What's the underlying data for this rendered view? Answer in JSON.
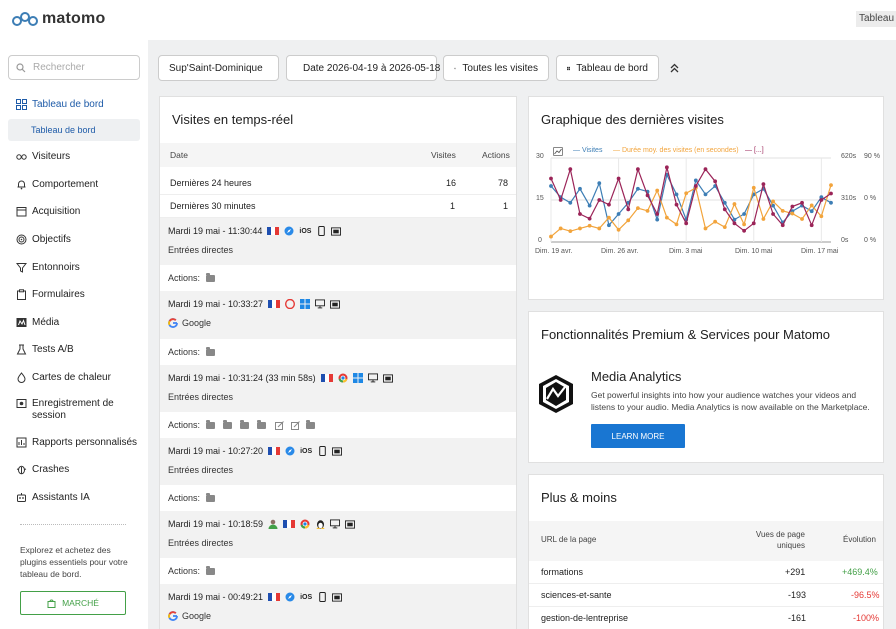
{
  "app": {
    "name": "matomo",
    "top_right_label": "Tableau d"
  },
  "search": {
    "placeholder": "Rechercher"
  },
  "sidebar": {
    "items": [
      {
        "label": "Tableau de bord",
        "icon": "dashboard-icon"
      },
      {
        "label": "Visiteurs",
        "icon": "glasses-icon"
      },
      {
        "label": "Comportement",
        "icon": "bell-icon"
      },
      {
        "label": "Acquisition",
        "icon": "calendar-icon"
      },
      {
        "label": "Objectifs",
        "icon": "target-icon"
      },
      {
        "label": "Entonnoirs",
        "icon": "funnel-icon"
      },
      {
        "label": "Formulaires",
        "icon": "clipboard-icon"
      },
      {
        "label": "Média",
        "icon": "media-icon"
      },
      {
        "label": "Tests A/B",
        "icon": "flask-icon"
      },
      {
        "label": "Cartes de chaleur",
        "icon": "flame-icon"
      },
      {
        "label": "Enregistrement de session",
        "icon": "record-icon"
      },
      {
        "label": "Rapports personnalisés",
        "icon": "report-icon"
      },
      {
        "label": "Crashes",
        "icon": "bug-icon"
      },
      {
        "label": "Assistants IA",
        "icon": "robot-icon"
      }
    ],
    "sub_item": "Tableau de bord",
    "promo_text": "Explorez et achetez des plugins essentiels pour votre tableau de bord.",
    "market_label": "MARCHÉ"
  },
  "filters": {
    "site": "Sup'Saint-Dominique",
    "date_range": "Date 2026-04-19 à 2026-05-18",
    "segment": "Toutes les visites",
    "dashboard": "Tableau de bord"
  },
  "realtime": {
    "title": "Visites en temps-réel",
    "headers": {
      "date": "Date",
      "visits": "Visites",
      "actions": "Actions"
    },
    "rows": [
      {
        "period": "Dernières 24 heures",
        "visits": "16",
        "actions": "78"
      },
      {
        "period": "Dernières 30 minutes",
        "visits": "1",
        "actions": "1"
      }
    ],
    "actions_label": "Actions:",
    "visits": [
      {
        "time": "Mardi 19 mai - 11:30:44",
        "referrer": "Entrées directes",
        "os_label": "iOS"
      },
      {
        "time": "Mardi 19 mai - 10:33:27",
        "referrer": "Google",
        "os_label": ""
      },
      {
        "time": "Mardi 19 mai - 10:31:24 (33 min 58s)",
        "referrer": "Entrées directes",
        "os_label": ""
      },
      {
        "time": "Mardi 19 mai - 10:27:20",
        "referrer": "Entrées directes",
        "os_label": "iOS"
      },
      {
        "time": "Mardi 19 mai - 10:18:59",
        "referrer": "Entrées directes",
        "os_label": ""
      },
      {
        "time": "Mardi 19 mai - 00:49:21",
        "referrer": "Google",
        "os_label": "iOS"
      }
    ]
  },
  "graph": {
    "title": "Graphique des dernières visites",
    "legend": [
      "Visites",
      "Durée moy. des visites (en secondes)",
      "[...]"
    ],
    "y_left_ticks": [
      "30",
      "15",
      "0"
    ],
    "y_right1_ticks": [
      "620s",
      "310s",
      "0s"
    ],
    "y_right2_ticks": [
      "90 %",
      "0 %",
      "0 %"
    ],
    "x_ticks": [
      "Dim. 19 avr.",
      "Dim. 26 avr.",
      "Dim. 3 mai",
      "Dim. 10 mai",
      "Dim. 17 mai"
    ]
  },
  "chart_data": {
    "type": "line",
    "x": [
      "19 avr.",
      "20",
      "21",
      "22",
      "23",
      "24",
      "25",
      "26 avr.",
      "27",
      "28",
      "29",
      "30",
      "1 mai",
      "2",
      "3 mai",
      "4",
      "5",
      "6",
      "7",
      "8",
      "9",
      "10 mai",
      "11",
      "12",
      "13",
      "14",
      "15",
      "16",
      "17 mai",
      "18"
    ],
    "series": [
      {
        "name": "Visites",
        "color": "#3d7eb5",
        "axis": "left",
        "values": [
          20,
          16,
          14,
          19,
          13,
          21,
          6,
          10,
          14,
          19,
          18,
          8,
          24,
          17,
          8,
          22,
          17,
          20,
          14,
          8,
          10,
          17,
          19,
          13,
          7,
          11,
          13,
          11,
          16,
          14
        ]
      },
      {
        "name": "Durée moy. des visites (en secondes)",
        "color": "#f2a43c",
        "axis": "right",
        "values": [
          40,
          100,
          80,
          100,
          120,
          100,
          180,
          90,
          160,
          250,
          230,
          380,
          180,
          130,
          360,
          400,
          100,
          150,
          110,
          280,
          130,
          400,
          170,
          300,
          230,
          210,
          170,
          270,
          190,
          420
        ]
      },
      {
        "name": "[...]",
        "color": "#9b2458",
        "axis": "right2",
        "values": [
          68,
          45,
          78,
          30,
          25,
          45,
          40,
          68,
          35,
          78,
          50,
          30,
          80,
          40,
          20,
          60,
          78,
          65,
          35,
          20,
          12,
          20,
          62,
          30,
          18,
          38,
          42,
          18,
          45,
          52
        ]
      }
    ],
    "y_left_range": [
      0,
      30
    ],
    "y_right_range": [
      0,
      620
    ],
    "y_right2_range": [
      0,
      90
    ],
    "grid": true,
    "legend_position": "top"
  },
  "premium": {
    "title": "Fonctionnalités Premium & Services pour Matomo",
    "product_title": "Media Analytics",
    "product_desc": "Get powerful insights into how your audience watches your videos and listens to your audio. Media Analytics is now available on the Marketplace.",
    "button_label": "LEARN MORE"
  },
  "plusmoins": {
    "title": "Plus & moins",
    "headers": {
      "url": "URL de la page",
      "views": "Vues de page uniques",
      "evolution": "Évolution"
    },
    "rows": [
      {
        "url": "formations",
        "views": "+291",
        "evolution": "+469.4%",
        "trend": "up"
      },
      {
        "url": "sciences-et-sante",
        "views": "-193",
        "evolution": "-96.5%",
        "trend": "down"
      },
      {
        "url": "gestion-de-lentreprise",
        "views": "-161",
        "evolution": "-100%",
        "trend": "down"
      }
    ]
  }
}
